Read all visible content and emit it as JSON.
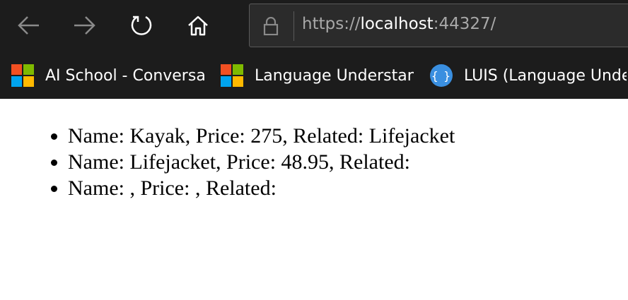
{
  "browser": {
    "address_bar": {
      "scheme": "https://",
      "host": "localhost",
      "rest": ":44327/"
    },
    "favorites": [
      {
        "label": "AI School - Conversational",
        "icon": "microsoft-logo-icon"
      },
      {
        "label": "Language Understanding",
        "icon": "microsoft-logo-icon"
      },
      {
        "label": "LUIS (Language Understanding)",
        "icon": "braces-icon"
      }
    ],
    "colors": {
      "chrome_bg": "#1c1c1c",
      "address_bg": "#2b2b2b"
    }
  },
  "page": {
    "items": [
      "Name: Kayak, Price: 275, Related: Lifejacket",
      "Name: Lifejacket, Price: 48.95, Related:",
      "Name: , Price: , Related:"
    ]
  }
}
